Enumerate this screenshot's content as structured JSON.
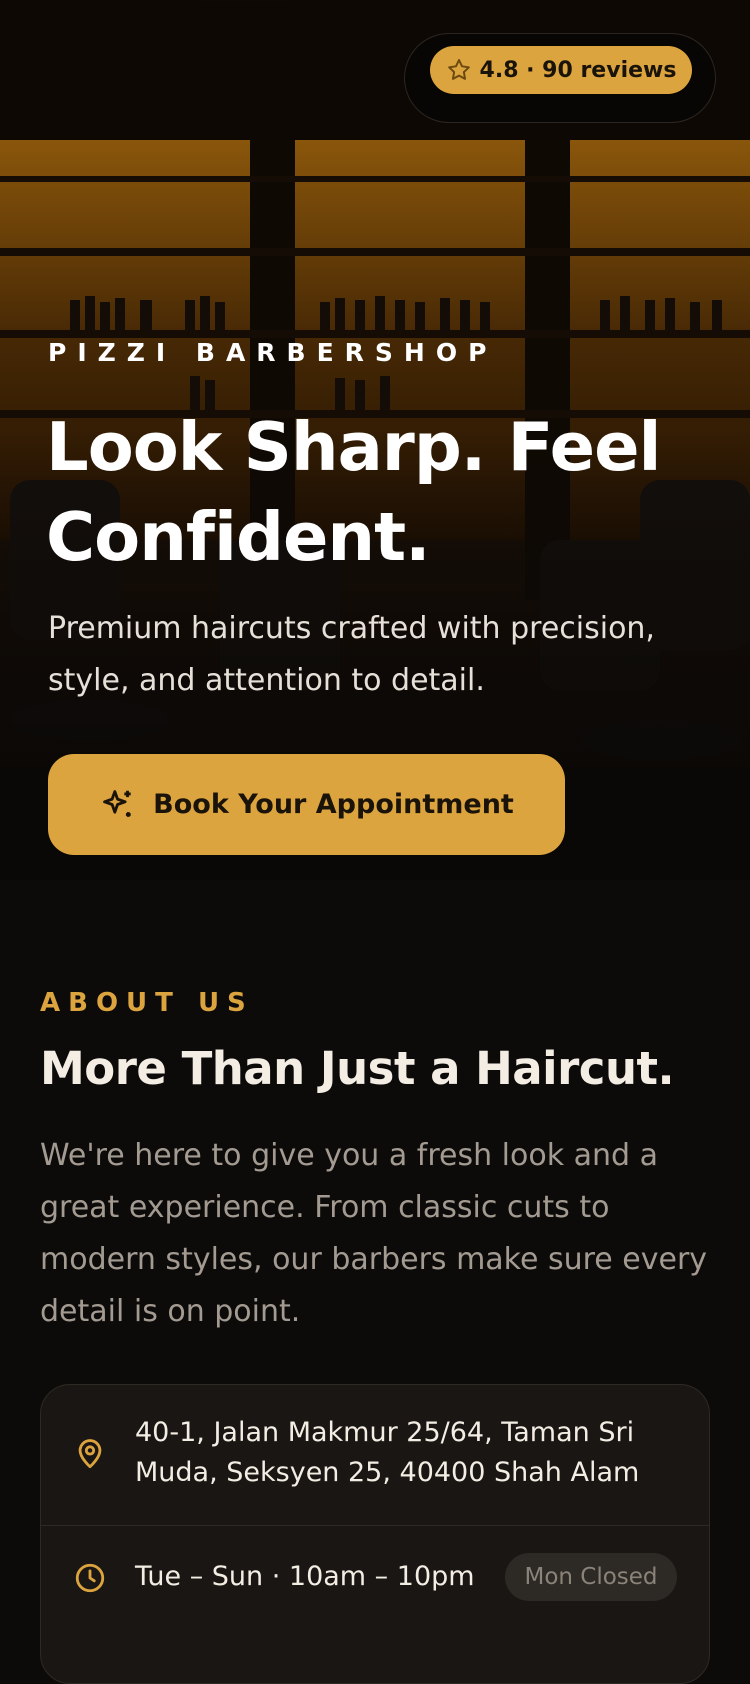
{
  "rating": {
    "text": "4.8 · 90 reviews",
    "icon": "star-outline-icon"
  },
  "hero": {
    "brand": "PIZZI BARBERSHOP",
    "headline": "Look Sharp. Feel Confident.",
    "subline": "Premium haircuts crafted with precision, style, and attention to detail.",
    "cta_label": "Book Your Appointment",
    "cta_icon": "sparkle-icon"
  },
  "about": {
    "eyebrow": "ABOUT US",
    "title": "More Than Just a Haircut.",
    "body": "We're here to give you a fresh look and a great experience. From classic cuts to modern styles, our barbers make sure every detail is on point."
  },
  "info": {
    "address": "40-1, Jalan Makmur 25/64, Taman Sri Muda, Seksyen 25, 40400 Shah Alam",
    "address_icon": "map-pin-icon",
    "hours": "Tue – Sun · 10am – 10pm",
    "hours_icon": "clock-icon",
    "closed_badge": "Mon Closed"
  },
  "colors": {
    "accent": "#dca43e",
    "background": "#0d0b0a",
    "card": "#1a1613",
    "muted_text": "#a39b91"
  }
}
